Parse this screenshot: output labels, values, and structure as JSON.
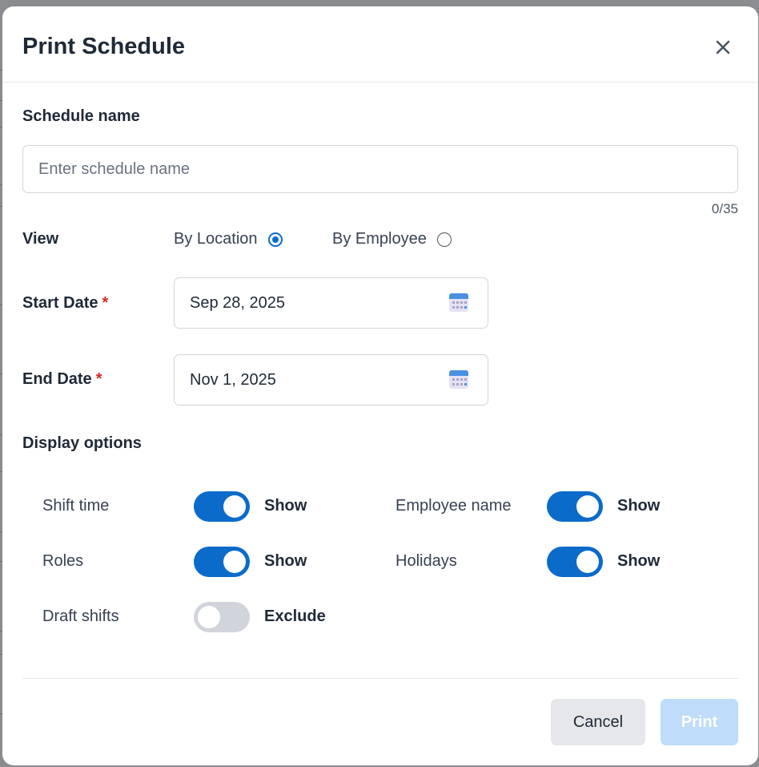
{
  "dialog": {
    "title": "Print Schedule",
    "close_icon": "close-icon"
  },
  "schedule_name": {
    "label": "Schedule name",
    "value": "",
    "placeholder": "Enter schedule name",
    "char_count": "0/35"
  },
  "view": {
    "label": "View",
    "options": [
      {
        "label": "By Location",
        "checked": true
      },
      {
        "label": "By Employee",
        "checked": false
      }
    ]
  },
  "start_date": {
    "label": "Start Date",
    "required_mark": "*",
    "value": "Sep 28, 2025",
    "icon": "calendar-icon"
  },
  "end_date": {
    "label": "End Date",
    "required_mark": "*",
    "value": "Nov 1, 2025",
    "icon": "calendar-icon"
  },
  "display_options": {
    "label": "Display options",
    "items": [
      {
        "label": "Shift time",
        "on": true,
        "state": "Show"
      },
      {
        "label": "Employee name",
        "on": true,
        "state": "Show"
      },
      {
        "label": "Roles",
        "on": true,
        "state": "Show"
      },
      {
        "label": "Holidays",
        "on": true,
        "state": "Show"
      },
      {
        "label": "Draft shifts",
        "on": false,
        "state": "Exclude"
      }
    ]
  },
  "footer": {
    "cancel_label": "Cancel",
    "print_label": "Print"
  },
  "colors": {
    "accent": "#0b6bcb",
    "print_disabled": "#bfdcfa",
    "required": "#dc2626"
  }
}
